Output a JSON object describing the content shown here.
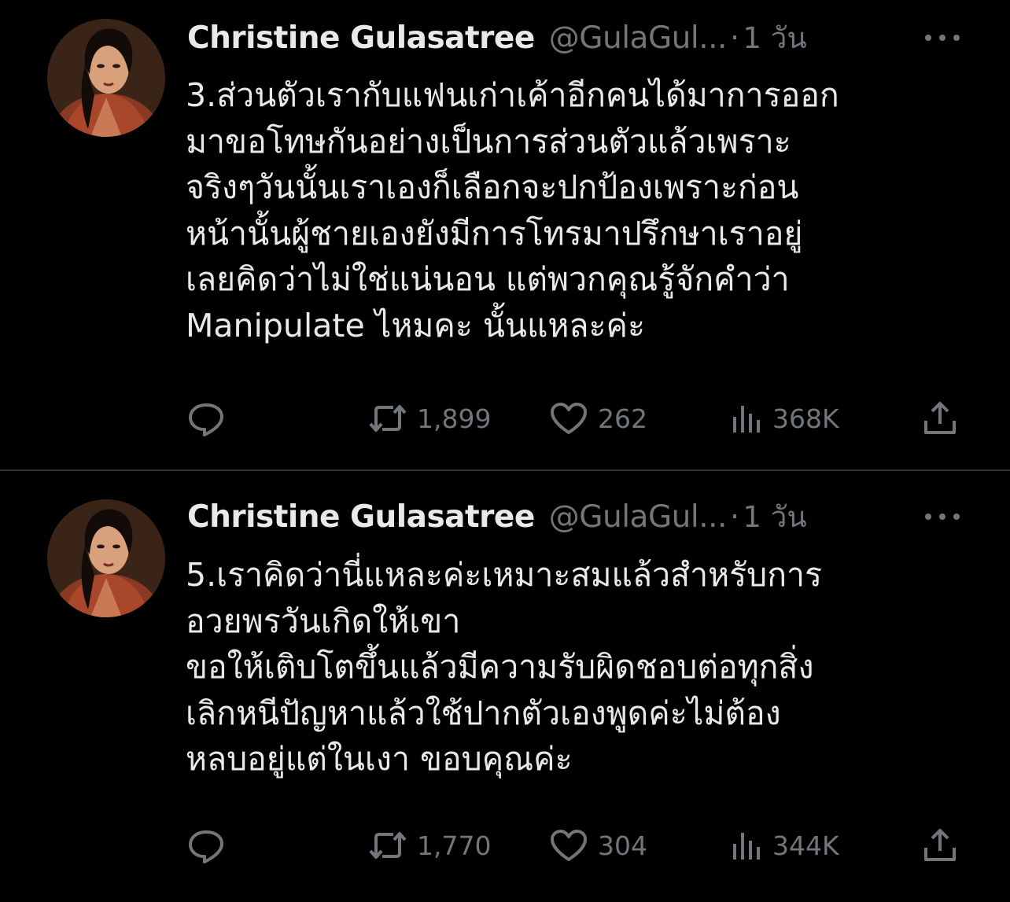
{
  "colors": {
    "background": "#000000",
    "text_primary": "#e7e9ea",
    "text_secondary": "#71767b",
    "divider": "#2f3336"
  },
  "tweets": [
    {
      "display_name": "Christine Gulasatree",
      "handle": "@GulaGul...",
      "separator": "·",
      "time": "1 วัน",
      "text": "3.ส่วนตัวเรากับแฟนเก่าเค้าอีกคนได้มาการออก\nมาขอโทษกันอย่างเป็นการส่วนตัวแล้วเพราะ\nจริงๆวันนั้นเราเองก็เลือกจะปกป้องเพราะก่อน\nหน้านั้นผู้ชายเองยังมีการโทรมาปรึกษาเราอยู่\nเลยคิดว่าไม่ใช่แน่นอน แต่พวกคุณรู้จักคำว่า\nManipulate ไหมคะ นั้นแหละค่ะ",
      "retweets": "1,899",
      "likes": "262",
      "views": "368K",
      "icons": {
        "avatar": "profile-photo",
        "more": "more-dots-icon",
        "reply": "reply-icon",
        "retweet": "retweet-icon",
        "like": "heart-icon",
        "views": "views-chart-icon",
        "share": "share-icon"
      }
    },
    {
      "display_name": "Christine Gulasatree",
      "handle": "@GulaGul...",
      "separator": "·",
      "time": "1 วัน",
      "text": "5.เราคิดว่านี่แหละค่ะเหมาะสมแล้วสำหรับการ\nอวยพรวันเกิดให้เขา\nขอให้เติบโตขึ้นแล้วมีความรับผิดชอบต่อทุกสิ่ง\nเลิกหนีปัญหาแล้วใช้ปากตัวเองพูดค่ะไม่ต้อง\nหลบอยู่แต่ในเงา ขอบคุณค่ะ",
      "retweets": "1,770",
      "likes": "304",
      "views": "344K",
      "icons": {
        "avatar": "profile-photo",
        "more": "more-dots-icon",
        "reply": "reply-icon",
        "retweet": "retweet-icon",
        "like": "heart-icon",
        "views": "views-chart-icon",
        "share": "share-icon"
      }
    }
  ]
}
